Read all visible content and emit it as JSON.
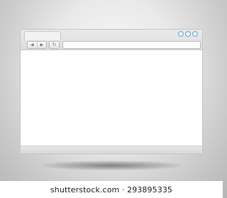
{
  "browser": {
    "controls": [
      {
        "icon": "circle-icon"
      },
      {
        "icon": "circle-icon"
      },
      {
        "icon": "circle-icon"
      }
    ],
    "nav": {
      "back_glyph": "◀",
      "forward_glyph": "▶",
      "reload_glyph": "↻"
    },
    "address": {
      "value": "",
      "placeholder": ""
    }
  },
  "footer": {
    "text": "shutterstock.com · 293895335"
  },
  "colors": {
    "control_ring": "#5da8dc",
    "chrome": "#e0e0e0",
    "background": "#c9c9c9"
  }
}
